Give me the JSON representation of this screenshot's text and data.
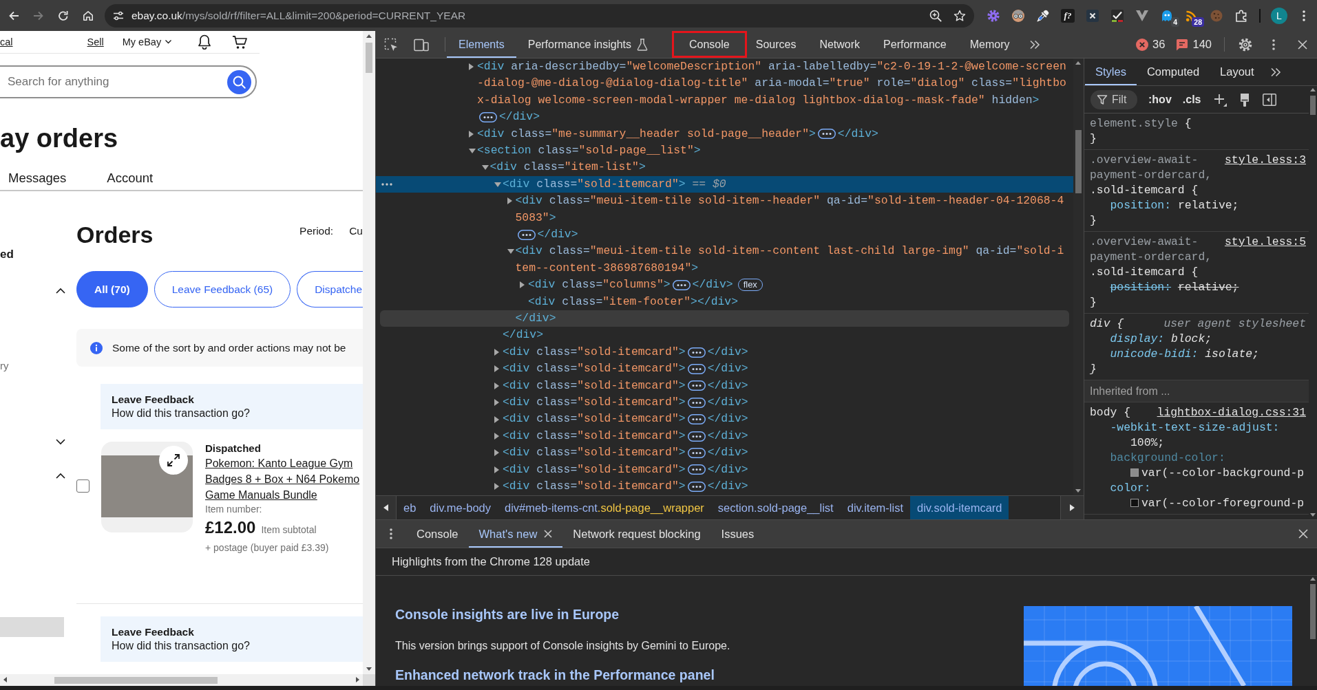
{
  "browser": {
    "nav_buttons": [
      {
        "kind": "back",
        "disabled": false
      },
      {
        "kind": "forward",
        "disabled": true
      },
      {
        "kind": "reload",
        "disabled": false
      },
      {
        "kind": "home",
        "disabled": false
      }
    ],
    "address_bar": {
      "host": "ebay.co.uk",
      "path": "/mys/sold/rf/filter=ALL&limit=200&period=CURRENT_YEAR"
    },
    "extensions": [
      {
        "kind": "gear"
      },
      {
        "kind": "face"
      },
      {
        "kind": "eyedropper"
      },
      {
        "kind": "lettermark",
        "text": "f?"
      },
      {
        "kind": "cross"
      },
      {
        "kind": "check"
      },
      {
        "kind": "v-shape"
      },
      {
        "kind": "ghost",
        "badge": "4"
      },
      {
        "kind": "feed",
        "badge": "28"
      },
      {
        "kind": "cookie"
      },
      {
        "kind": "puzzle"
      }
    ],
    "profile": {
      "initial": "L"
    }
  },
  "page": {
    "top_links": [
      {
        "text": "cal"
      },
      {
        "text": "Sell"
      }
    ],
    "account_menu": "My eBay",
    "search": {
      "placeholder": "Search for anything"
    },
    "title": "ay orders",
    "tabs": [
      {
        "label": "Messages",
        "selected": false
      },
      {
        "label": "Account",
        "selected": false
      }
    ],
    "sidebar": [
      {
        "kind": "heading",
        "text": "ed"
      },
      {
        "kind": "toggle",
        "expanded": true
      },
      {
        "kind": "option",
        "text": "ry"
      },
      {
        "kind": "toggle",
        "expanded": false
      },
      {
        "kind": "toggle",
        "expanded": true
      },
      {
        "kind": "bar"
      }
    ],
    "orders": {
      "title": "Orders",
      "period_label": "Period:",
      "period_value": "Cu",
      "filters": [
        {
          "label": "All (70)",
          "selected": true
        },
        {
          "label": "Leave Feedback (65)",
          "selected": false
        },
        {
          "label": "Dispatche",
          "selected": false
        }
      ],
      "notice": "Some of the sort by and order actions may not be",
      "cards": [
        {
          "prompt": {
            "title": "Leave Feedback",
            "question": "How did this transaction go?"
          },
          "checked": false,
          "status": "Dispatched",
          "title_lines": [
            "Pokemon: Kanto League Gym",
            "Badges 8 + Box + N64 Pokemo",
            "Game Manuals Bundle"
          ],
          "item_number": "Item number:",
          "price": "£12.00",
          "price_note": "Item subtotal",
          "postage": "+ postage (buyer paid £3.39)"
        },
        {
          "prompt": {
            "title": "Leave Feedback",
            "question": "How did this transaction go?"
          }
        }
      ]
    }
  },
  "devtools": {
    "tabs": [
      {
        "label": "Elements",
        "kind": "plain",
        "selected": true,
        "annotated": false
      },
      {
        "label": "Performance insights",
        "kind": "experimental",
        "selected": false,
        "annotated": false
      },
      {
        "label": "Console",
        "kind": "plain",
        "selected": false,
        "annotated": true
      },
      {
        "label": "Sources",
        "kind": "plain",
        "selected": false,
        "annotated": false
      },
      {
        "label": "Network",
        "kind": "plain",
        "selected": false,
        "annotated": false
      },
      {
        "label": "Performance",
        "kind": "plain",
        "selected": false,
        "annotated": false
      },
      {
        "label": "Memory",
        "kind": "plain",
        "selected": false,
        "annotated": false
      }
    ],
    "error_count": "36",
    "issue_count": "140",
    "elements": {
      "nodes": [
        {
          "kind": "parent",
          "open": "<div aria-describedby=\"welcomeDescription\" aria-labelledby=\"c2-0-19-1-2-@welcome-screen-dialog-@me-dialog-@dialog-dialog-title\" aria-modal=\"true\" role=\"dialog\" class=\"lightbox-dialog welcome-screen-modal-wrapper me-dialog lightbox-dialog--mask-fade\" hidden>",
          "close": "</div>",
          "expanded": false,
          "selected": false,
          "hovered": false
        },
        {
          "kind": "parent",
          "open": "<div class=\"me-summary__header sold-page__header\">",
          "close": "</div>",
          "expanded": false,
          "selected": false,
          "hovered": false
        },
        {
          "kind": "parent",
          "open": "<section class=\"sold-page__list\">",
          "expanded": true,
          "selected": false,
          "hovered": false,
          "children": [
            {
              "kind": "parent",
              "open": "<div class=\"item-list\">",
              "expanded": true,
              "selected": false,
              "hovered": false,
              "children": [
                {
                  "kind": "parent",
                  "open": "<div class=\"sold-itemcard\">",
                  "reference": "== $0",
                  "close": "</div>",
                  "expanded": true,
                  "selected": true,
                  "hovered": false,
                  "children": [
                    {
                      "kind": "parent",
                      "open": "<div class=\"meui-item-tile sold-item--header\" qa-id=\"sold-item--header-04-12068-45083\">",
                      "close": "</div>",
                      "expanded": false,
                      "selected": false,
                      "hovered": false
                    },
                    {
                      "kind": "parent",
                      "open": "<div class=\"meui-item-tile sold-item--content last-child large-img\" qa-id=\"sold-item--content-386987680194\">",
                      "close": "</div>",
                      "expanded": true,
                      "selected": false,
                      "hovered": true,
                      "children": [
                        {
                          "kind": "parent",
                          "open": "<div class=\"columns\">",
                          "close": "</div>",
                          "badge": "flex",
                          "expanded": false,
                          "selected": false,
                          "hovered": false
                        },
                        {
                          "kind": "leaf",
                          "open": "<div class=\"item-footer\">",
                          "close": "</div>",
                          "selected": false,
                          "hovered": false
                        }
                      ]
                    }
                  ]
                },
                {
                  "kind": "parent",
                  "open": "<div class=\"sold-itemcard\">",
                  "close": "</div>",
                  "expanded": false,
                  "selected": false,
                  "hovered": false
                },
                {
                  "kind": "parent",
                  "open": "<div class=\"sold-itemcard\">",
                  "close": "</div>",
                  "expanded": false,
                  "selected": false,
                  "hovered": false
                },
                {
                  "kind": "parent",
                  "open": "<div class=\"sold-itemcard\">",
                  "close": "</div>",
                  "expanded": false,
                  "selected": false,
                  "hovered": false
                },
                {
                  "kind": "parent",
                  "open": "<div class=\"sold-itemcard\">",
                  "close": "</div>",
                  "expanded": false,
                  "selected": false,
                  "hovered": false
                },
                {
                  "kind": "parent",
                  "open": "<div class=\"sold-itemcard\">",
                  "close": "</div>",
                  "expanded": false,
                  "selected": false,
                  "hovered": false
                },
                {
                  "kind": "parent",
                  "open": "<div class=\"sold-itemcard\">",
                  "close": "</div>",
                  "expanded": false,
                  "selected": false,
                  "hovered": false
                },
                {
                  "kind": "parent",
                  "open": "<div class=\"sold-itemcard\">",
                  "close": "</div>",
                  "expanded": false,
                  "selected": false,
                  "hovered": false
                },
                {
                  "kind": "parent",
                  "open": "<div class=\"sold-itemcard\">",
                  "close": "</div>",
                  "expanded": false,
                  "selected": false,
                  "hovered": false
                },
                {
                  "kind": "parent",
                  "open": "<div class=\"sold-itemcard\">",
                  "close": "</div>",
                  "expanded": false,
                  "selected": false,
                  "hovered": false
                }
              ]
            }
          ]
        }
      ]
    },
    "breadcrumbs": [
      {
        "parts": [
          {
            "text": "eb",
            "accent": false
          }
        ],
        "selected": false
      },
      {
        "parts": [
          {
            "text": "div.me-body",
            "accent": false
          }
        ],
        "selected": false
      },
      {
        "parts": [
          {
            "text": "div#meb-items-cnt",
            "accent": false
          },
          {
            "text": ".sold-page__wrapper",
            "accent": true
          }
        ],
        "selected": false
      },
      {
        "parts": [
          {
            "text": "section.sold-page__list",
            "accent": false
          }
        ],
        "selected": false
      },
      {
        "parts": [
          {
            "text": "div.item-list",
            "accent": false
          }
        ],
        "selected": false
      },
      {
        "parts": [
          {
            "text": "div.sold-itemcard",
            "accent": false
          }
        ],
        "selected": true
      }
    ],
    "styles": {
      "tabs": [
        {
          "label": "Styles",
          "selected": true
        },
        {
          "label": "Computed",
          "selected": false
        },
        {
          "label": "Layout",
          "selected": false
        }
      ],
      "filter": {
        "placeholder": "Filt"
      },
      "toggles": [
        ":hov",
        ".cls"
      ],
      "rules": [
        {
          "kind": "rule",
          "selector": [
            {
              "text": "element.style",
              "matched": false
            },
            {
              "text": " {",
              "matched": true
            }
          ],
          "close": "}"
        },
        {
          "kind": "rule",
          "selector": [
            {
              "text": ".overview-await-payment-ordercard, ",
              "matched": false
            },
            {
              "text": ".sold-itemcard {",
              "matched": true
            }
          ],
          "source": "style.less:3",
          "declarations": [
            {
              "property": "position:",
              "value": "relative;",
              "overridden": false,
              "dimmed": false
            }
          ],
          "close": "}"
        },
        {
          "kind": "rule",
          "selector": [
            {
              "text": ".overview-await-payment-ordercard, ",
              "matched": false
            },
            {
              "text": ".sold-itemcard {",
              "matched": true
            }
          ],
          "source": "style.less:5",
          "declarations": [
            {
              "property": "position:",
              "value": "relative;",
              "overridden": true,
              "dimmed": false
            }
          ],
          "close": "}"
        },
        {
          "kind": "user-agent",
          "selector": [
            {
              "text": "div {",
              "matched": true
            }
          ],
          "origin": "user agent stylesheet",
          "declarations": [
            {
              "property": "display:",
              "value": "block;",
              "overridden": false,
              "dimmed": false
            },
            {
              "property": "unicode-bidi:",
              "value": "isolate;",
              "overridden": false,
              "dimmed": false
            }
          ],
          "close": "}"
        },
        {
          "kind": "section",
          "text": "Inherited from ..."
        },
        {
          "kind": "rule",
          "selector": [
            {
              "text": "body {",
              "matched": true
            }
          ],
          "source": "lightbox-dialog.css:31",
          "declarations": [
            {
              "property": "-webkit-text-size-adjust:",
              "value": "100%;",
              "overridden": false,
              "dimmed": false
            },
            {
              "property": "background-color:",
              "value": "var(--color-background-p",
              "color": "#8c8c8c",
              "overridden": false,
              "dimmed": true
            },
            {
              "property": "color:",
              "value": "var(--color-foreground-p",
              "color": "#111111",
              "overridden": false,
              "dimmed": false
            }
          ]
        }
      ]
    },
    "drawer": {
      "tabs": [
        {
          "label": "Console",
          "selected": false,
          "closable": false
        },
        {
          "label": "What's new",
          "selected": true,
          "closable": true
        },
        {
          "label": "Network request blocking",
          "selected": false,
          "closable": false
        },
        {
          "label": "Issues",
          "selected": false,
          "closable": false
        }
      ],
      "heading": "Highlights from the Chrome 128 update",
      "articles": [
        {
          "title": "Console insights are live in Europe",
          "body": "This version brings support of Console insights by Gemini to Europe."
        },
        {
          "title": "Enhanced network track in the Performance panel"
        }
      ]
    }
  }
}
